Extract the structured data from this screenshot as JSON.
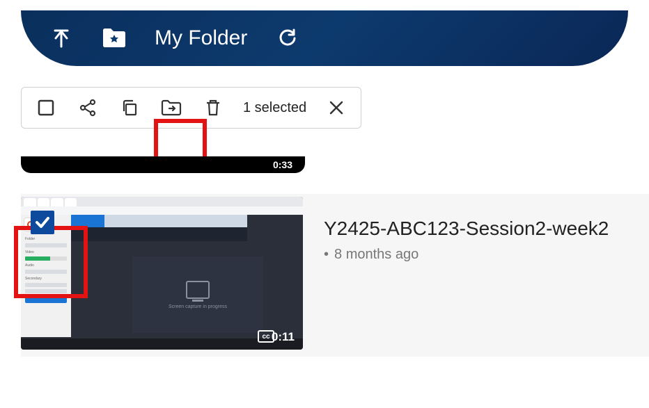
{
  "header": {
    "title": "My Folder"
  },
  "toolbar": {
    "selection_text": "1 selected"
  },
  "preview_above": {
    "duration": "0:33"
  },
  "video": {
    "title": "Y2425-ABC123-Session2-week2",
    "age": "8 months ago",
    "duration": "0:11",
    "cc": "cc",
    "thumb_caption": "Screen capture in progress"
  }
}
